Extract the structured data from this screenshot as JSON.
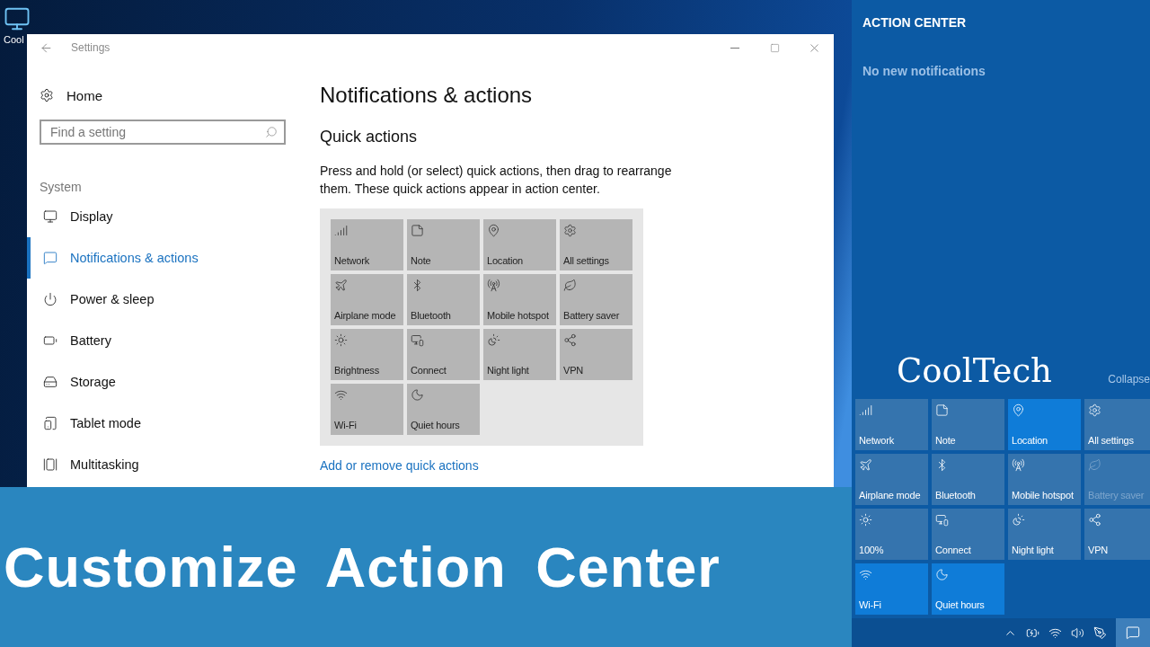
{
  "desktop_icon": {
    "label": "Cool"
  },
  "window": {
    "title": "Settings"
  },
  "sidebar": {
    "home": "Home",
    "search": {
      "placeholder": "Find a setting"
    },
    "section": "System",
    "items": [
      {
        "label": "Display",
        "selected": false
      },
      {
        "label": "Notifications & actions",
        "selected": true
      },
      {
        "label": "Power & sleep",
        "selected": false
      },
      {
        "label": "Battery",
        "selected": false
      },
      {
        "label": "Storage",
        "selected": false
      },
      {
        "label": "Tablet mode",
        "selected": false
      },
      {
        "label": "Multitasking",
        "selected": false
      }
    ]
  },
  "content": {
    "title": "Notifications & actions",
    "subtitle": "Quick actions",
    "description": "Press and hold (or select) quick actions, then drag to rearrange them. These quick actions appear in action center.",
    "tiles": [
      {
        "label": "Network"
      },
      {
        "label": "Note"
      },
      {
        "label": "Location"
      },
      {
        "label": "All settings"
      },
      {
        "label": "Airplane mode"
      },
      {
        "label": "Bluetooth"
      },
      {
        "label": "Mobile hotspot"
      },
      {
        "label": "Battery saver"
      },
      {
        "label": "Brightness"
      },
      {
        "label": "Connect"
      },
      {
        "label": "Night light"
      },
      {
        "label": "VPN"
      },
      {
        "label": "Wi-Fi"
      },
      {
        "label": "Quiet hours"
      }
    ],
    "link": "Add or remove quick actions"
  },
  "banner": {
    "title": "Customize Action Center"
  },
  "action_center": {
    "title": "ACTION CENTER",
    "empty_message": "No new notifications",
    "brand": "CoolTech",
    "collapse": "Collapse",
    "tiles": [
      {
        "label": "Network",
        "on": false,
        "disabled": false
      },
      {
        "label": "Note",
        "on": false,
        "disabled": false
      },
      {
        "label": "Location",
        "on": true,
        "disabled": false
      },
      {
        "label": "All settings",
        "on": false,
        "disabled": false
      },
      {
        "label": "Airplane mode",
        "on": false,
        "disabled": false
      },
      {
        "label": "Bluetooth",
        "on": false,
        "disabled": false
      },
      {
        "label": "Mobile hotspot",
        "on": false,
        "disabled": false
      },
      {
        "label": "Battery saver",
        "on": false,
        "disabled": true
      },
      {
        "label": "100%",
        "on": false,
        "disabled": false
      },
      {
        "label": "Connect",
        "on": false,
        "disabled": false
      },
      {
        "label": "Night light",
        "on": false,
        "disabled": false
      },
      {
        "label": "VPN",
        "on": false,
        "disabled": false
      },
      {
        "label": "Wi-Fi",
        "on": true,
        "disabled": false
      },
      {
        "label": "Quiet hours",
        "on": true,
        "disabled": false
      }
    ]
  }
}
